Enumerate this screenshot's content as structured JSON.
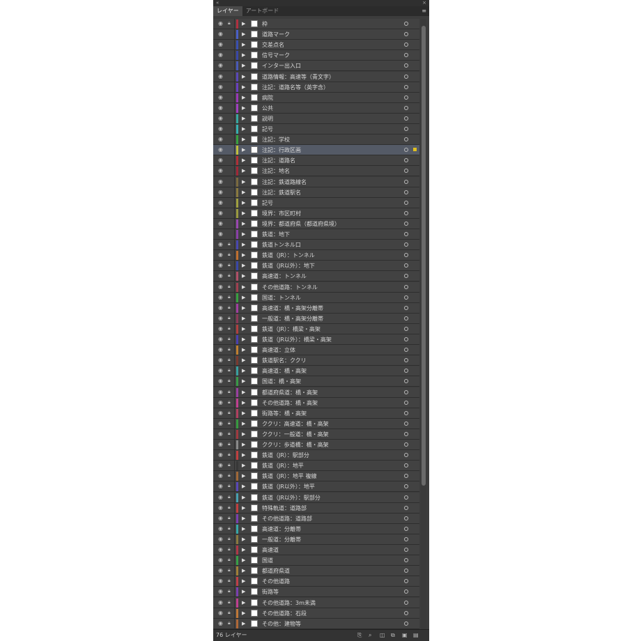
{
  "window": {
    "collapse_glyph": "«",
    "close_glyph": "×",
    "tabs": [
      {
        "label": "レイヤー",
        "active": true
      },
      {
        "label": "アートボード",
        "active": false
      }
    ],
    "menu_glyph": "≡"
  },
  "layers": [
    {
      "name": "枠",
      "color": "#b03040",
      "locked": true
    },
    {
      "name": "道路マーク",
      "color": "#4a60c8",
      "locked": false
    },
    {
      "name": "交差点名",
      "color": "#3a50b0",
      "locked": false
    },
    {
      "name": "信号マーク",
      "color": "#3a48a8",
      "locked": false
    },
    {
      "name": "インター出入口",
      "color": "#4a5ab8",
      "locked": false
    },
    {
      "name": "道路情報：高速等（青文字）",
      "color": "#5a48b8",
      "locked": false
    },
    {
      "name": "注記：道路名等（英字含）",
      "color": "#6a40c0",
      "locked": false
    },
    {
      "name": "病院",
      "color": "#9a38b8",
      "locked": false
    },
    {
      "name": "公共",
      "color": "#a040c0",
      "locked": false
    },
    {
      "name": "説明",
      "color": "#38a8a0",
      "locked": false
    },
    {
      "name": "記号",
      "color": "#38b0b0",
      "locked": false
    },
    {
      "name": "注記：学校",
      "color": "#38a040",
      "locked": false
    },
    {
      "name": "注記：行政区画",
      "color": "#c0c040",
      "locked": false,
      "selected": true
    },
    {
      "name": "注記：道路名",
      "color": "#b03038",
      "locked": false
    },
    {
      "name": "注記：地名",
      "color": "#a02838",
      "locked": false
    },
    {
      "name": "注記：鉄道路線名",
      "color": "#7a6a40",
      "locked": false
    },
    {
      "name": "注記：鉄道駅名",
      "color": "#8a7a40",
      "locked": false
    },
    {
      "name": "記号",
      "color": "#a0a040",
      "locked": false
    },
    {
      "name": "境界：市区町村",
      "color": "#9a9a40",
      "locked": false
    },
    {
      "name": "境界：都道府県（都道府県境）",
      "color": "#9a48b0",
      "locked": false
    },
    {
      "name": "鉄道：地下",
      "color": "#8a40a8",
      "locked": false
    },
    {
      "name": "鉄道トンネル口",
      "color": "#4a48b0",
      "locked": true
    },
    {
      "name": "鉄道（JR）：トンネル",
      "color": "#c07030",
      "locked": true
    },
    {
      "name": "鉄道（JR以外）：地下",
      "color": "#3a48a8",
      "locked": true
    },
    {
      "name": "高速道：トンネル",
      "color": "#b05068",
      "locked": true
    },
    {
      "name": "その他道路：トンネル",
      "color": "#a04050",
      "locked": true
    },
    {
      "name": "国道：トンネル",
      "color": "#38a040",
      "locked": true
    },
    {
      "name": "高速道：橋・高架分離帯",
      "color": "#a040a0",
      "locked": true
    },
    {
      "name": "一般道：橋・高架分離帯",
      "color": "#8a3a58",
      "locked": true
    },
    {
      "name": "鉄道（JR）：橋梁・高架",
      "color": "#b04040",
      "locked": true
    },
    {
      "name": "鉄道（JR以外）：橋梁・高架",
      "color": "#4a40b0",
      "locked": true
    },
    {
      "name": "高速道：立体",
      "color": "#c08030",
      "locked": true
    },
    {
      "name": "鉄道駅名：ククリ",
      "color": "#7a3a30",
      "locked": true
    },
    {
      "name": "高速道：橋・高架",
      "color": "#3aa0a0",
      "locked": true
    },
    {
      "name": "国道：橋・高架",
      "color": "#3a9a48",
      "locked": true
    },
    {
      "name": "都道府県道：橋・高架",
      "color": "#9a40a0",
      "locked": true
    },
    {
      "name": "その他道路：橋・高架",
      "color": "#c04090",
      "locked": true
    },
    {
      "name": "街路等：橋・高架",
      "color": "#b04060",
      "locked": true
    },
    {
      "name": "ククリ：高速道：橋・高架",
      "color": "#389a40",
      "locked": true
    },
    {
      "name": "ククリ：一般道：橋・高架",
      "color": "#a03a40",
      "locked": true
    },
    {
      "name": "ククリ：歩道橋：橋・高架",
      "color": "#8a8a8a",
      "locked": true
    },
    {
      "name": "鉄道（JR）：駅部分",
      "color": "#c04040",
      "locked": true
    },
    {
      "name": "鉄道（JR）：地平",
      "color": "#383838",
      "locked": true
    },
    {
      "name": "鉄道（JR）：地平 複線",
      "color": "#a06838",
      "locked": true
    },
    {
      "name": "鉄道（JR以外）：地平",
      "color": "#5a48b8",
      "locked": true
    },
    {
      "name": "鉄道（JR以外）：駅部分",
      "color": "#48a0b0",
      "locked": true
    },
    {
      "name": "特殊軌道：道路部",
      "color": "#c04040",
      "locked": true
    },
    {
      "name": "その他道路：道路部",
      "color": "#7a40b0",
      "locked": true
    },
    {
      "name": "高速道：分離帯",
      "color": "#38a8a8",
      "locked": true
    },
    {
      "name": "一般道：分離帯",
      "color": "#8a7a40",
      "locked": true
    },
    {
      "name": "高速道",
      "color": "#b03848",
      "locked": true
    },
    {
      "name": "国道",
      "color": "#38a048",
      "locked": true
    },
    {
      "name": "都道府県道",
      "color": "#a08038",
      "locked": true
    },
    {
      "name": "その他道路",
      "color": "#c04048",
      "locked": true
    },
    {
      "name": "街路等",
      "color": "#7a40b0",
      "locked": true
    },
    {
      "name": "その他道路：3m未満",
      "color": "#c04090",
      "locked": true
    },
    {
      "name": "その他道路：石段",
      "color": "#c07838",
      "locked": true
    },
    {
      "name": "その他：建物等",
      "color": "#b06838",
      "locked": true
    }
  ],
  "footer": {
    "count_label": "76 レイヤー",
    "icons": [
      "export-icon",
      "locate-icon",
      "make-clip-icon",
      "new-sublayer-icon",
      "new-layer-icon",
      "delete-icon"
    ]
  }
}
